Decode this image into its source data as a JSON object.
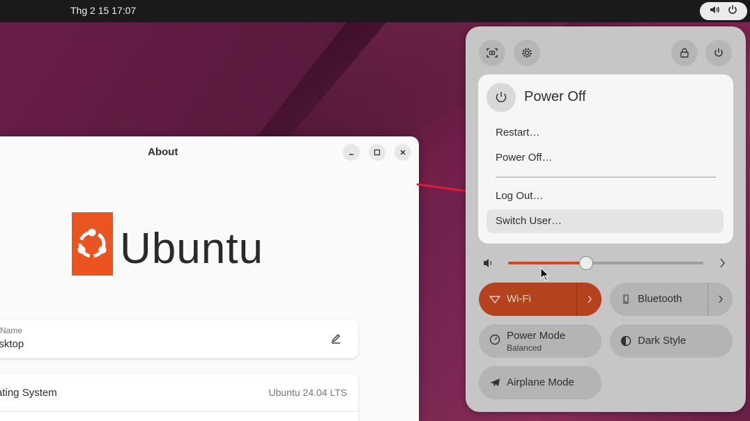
{
  "topbar": {
    "clock": "Thg 2 15  17:07",
    "tray_icons": [
      "speaker-icon",
      "power-icon"
    ]
  },
  "about_window": {
    "title": "About",
    "controls": [
      "minimize-icon",
      "maximize-icon",
      "close-icon"
    ],
    "logo_text": "Ubuntu",
    "logo_color": "#e95420",
    "device_name": {
      "label": "e Name",
      "value": "esktop"
    },
    "os_row": {
      "label": "rating System",
      "value": "Ubuntu 24.04 LTS"
    }
  },
  "quick_settings": {
    "top_buttons": [
      "screenshot-icon",
      "settings-icon",
      "lock-icon",
      "power-icon"
    ],
    "power_menu": {
      "title": "Power Off",
      "items": [
        "Restart…",
        "Power Off…",
        "Log Out…",
        "Switch User…"
      ]
    },
    "volume": {
      "level": 0.4
    },
    "tiles": {
      "wifi": {
        "label": "Wi-Fi",
        "active": true
      },
      "bluetooth": {
        "label": "Bluetooth",
        "active": false
      },
      "power_mode": {
        "label": "Power Mode",
        "sub": "Balanced"
      },
      "dark_style": {
        "label": "Dark Style"
      },
      "airplane": {
        "label": "Airplane Mode"
      }
    }
  },
  "colors": {
    "accent": "#b4421c",
    "slider_fill": "#d44520",
    "annotation_arrow": "#e01b3a"
  }
}
